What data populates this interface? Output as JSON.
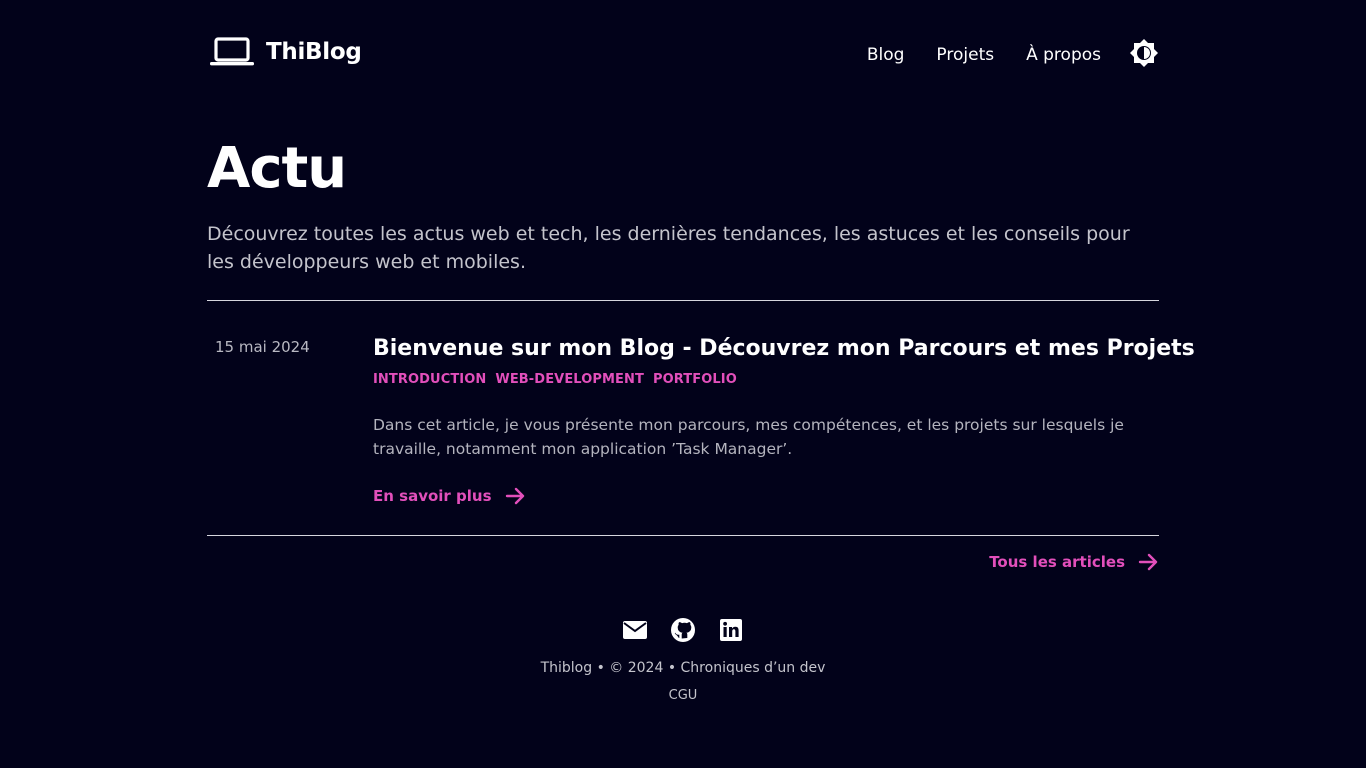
{
  "header": {
    "brand_name": "ThiBlog",
    "nav": [
      {
        "label": "Blog"
      },
      {
        "label": "Projets"
      },
      {
        "label": "À propos"
      }
    ]
  },
  "hero": {
    "title": "Actu",
    "description": "Découvrez toutes les actus web et tech, les dernières tendances, les astuces et les conseils pour les développeurs web et mobiles."
  },
  "posts": [
    {
      "date": "15 mai 2024",
      "title": "Bienvenue sur mon Blog - Découvrez mon Parcours et mes Projets",
      "tags": [
        "INTRODUCTION",
        "WEB-DEVELOPMENT",
        "PORTFOLIO"
      ],
      "summary": "Dans cet article, je vous présente mon parcours, mes compétences, et les projets sur lesquels je travaille, notamment mon application ’Task Manager’.",
      "read_more": "En savoir plus"
    }
  ],
  "all_articles_label": "Tous les articles",
  "footer": {
    "icons": [
      "mail-icon",
      "github-icon",
      "linkedin-icon"
    ],
    "line": "Thiblog • © 2024 • Chroniques d’un dev",
    "cgu": "CGU"
  },
  "colors": {
    "background": "#02021a",
    "accent": "#e24fbb",
    "text": "#ffffff",
    "muted": "#c4c4cc"
  }
}
